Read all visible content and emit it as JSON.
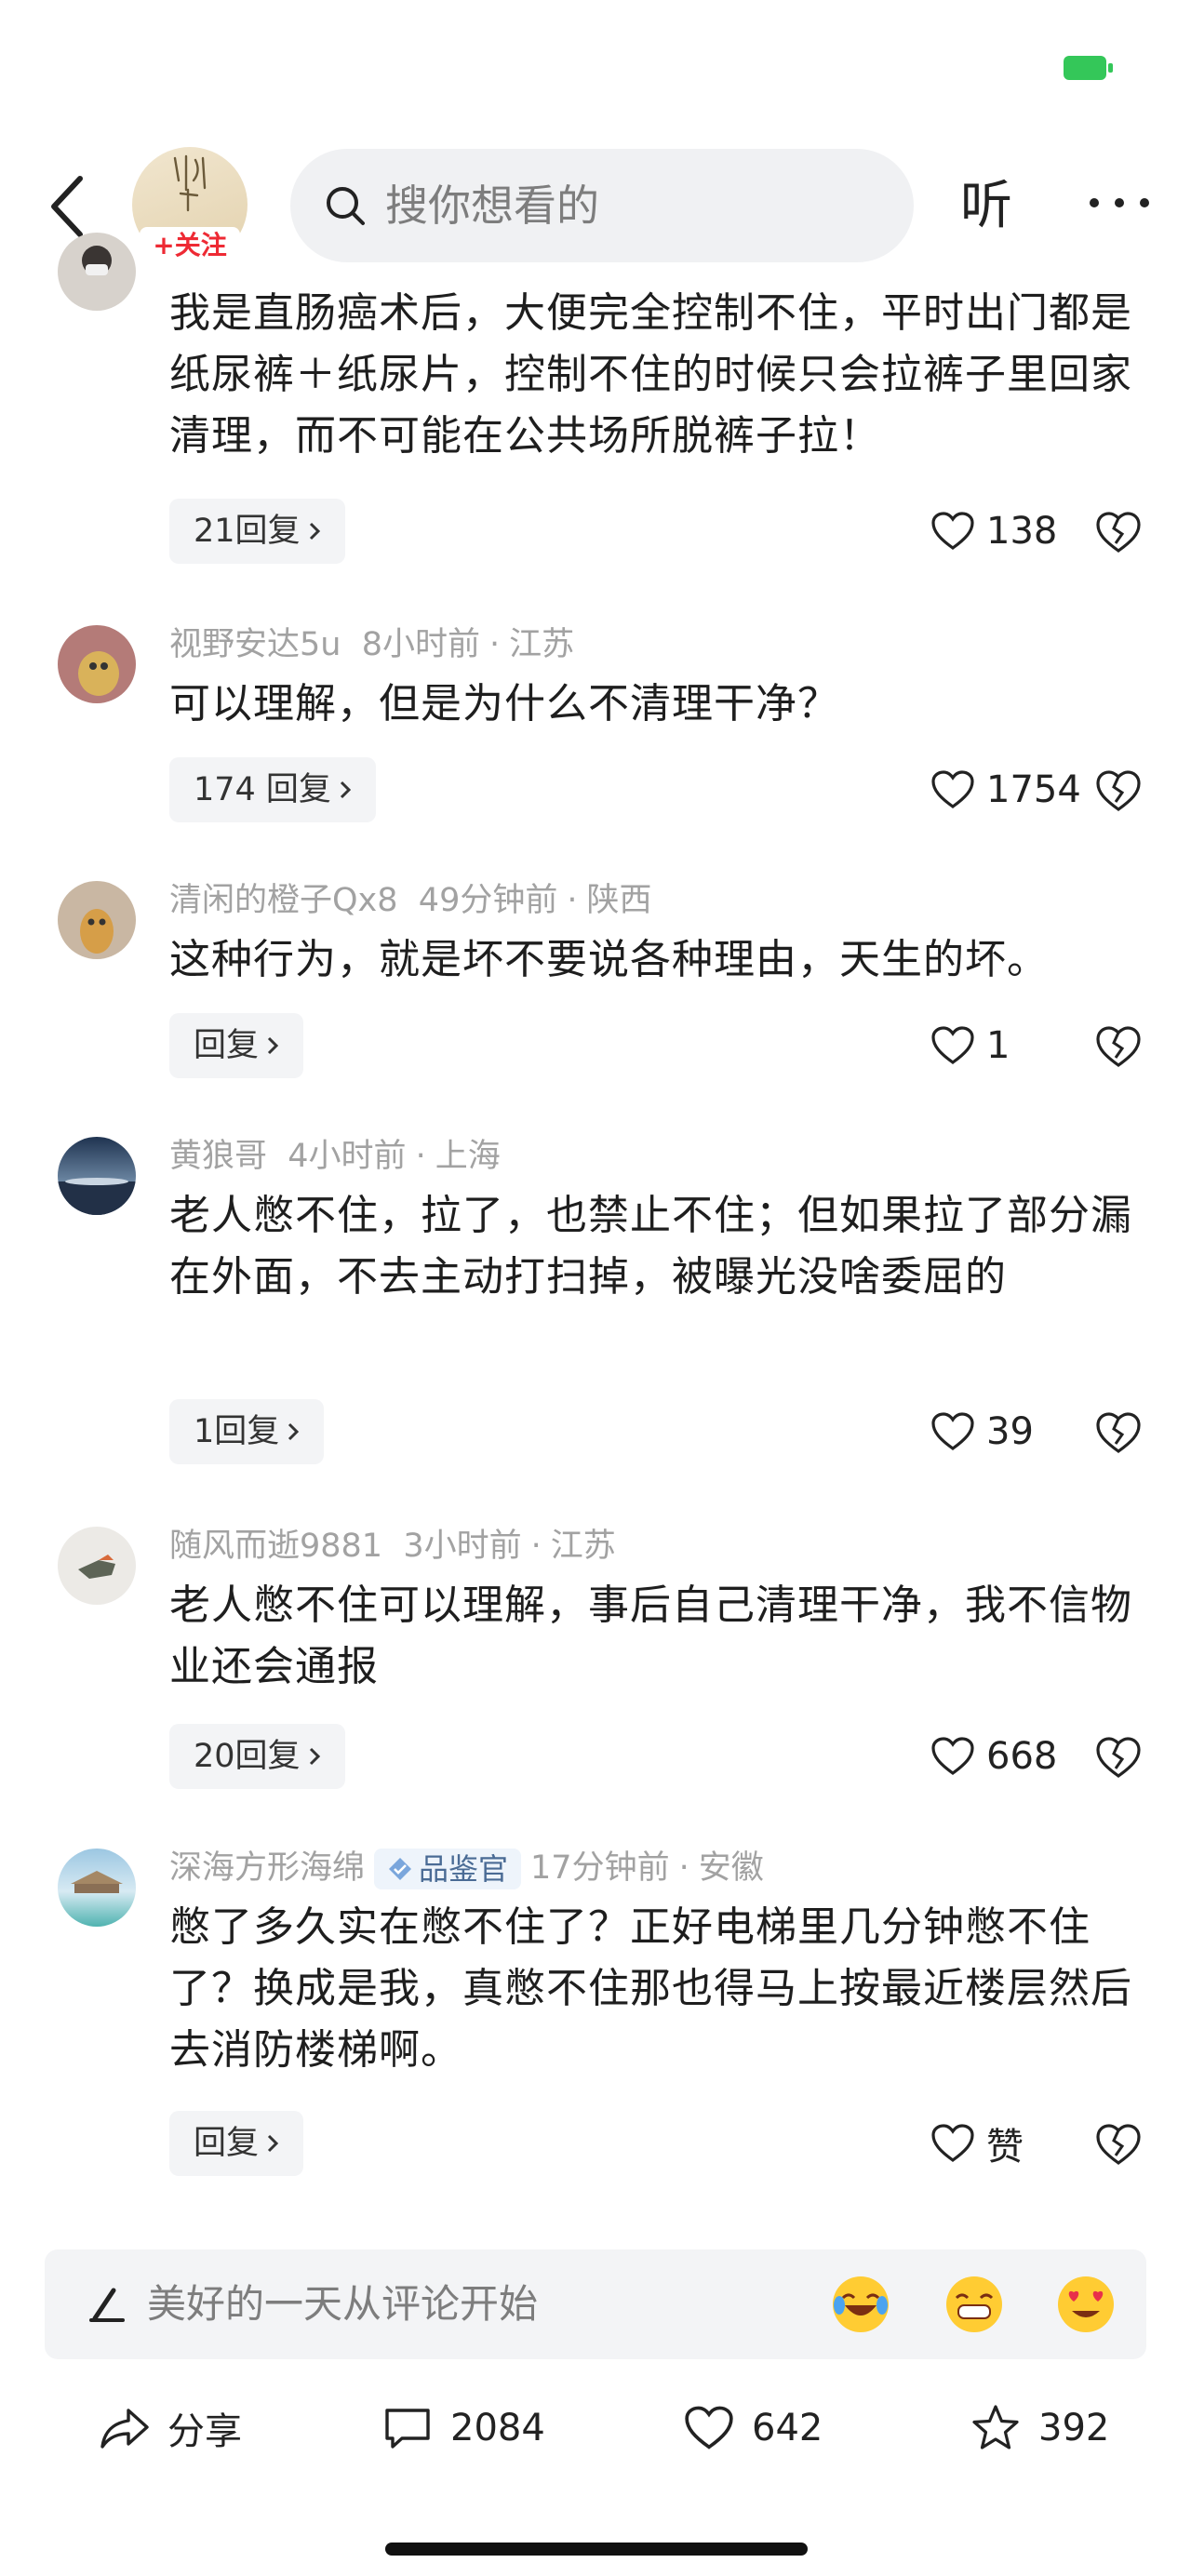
{
  "status": {
    "battery_color": "#34c759"
  },
  "header": {
    "follow_label": "+关注",
    "search_placeholder": "搜你想看的",
    "listen_label": "听"
  },
  "comments": [
    {
      "user": "",
      "time": "",
      "location": "",
      "text": "我是直肠癌术后，大便完全控制不住，平时出门都是纸尿裤＋纸尿片，控制不住的时候只会拉裤子里回家清理，而不可能在公共场所脱裤子拉！",
      "replies": "21回复",
      "likes": "138"
    },
    {
      "user": "视野安达5u",
      "time": "8小时前",
      "location": "江苏",
      "text": "可以理解，但是为什么不清理干净？",
      "replies": "174 回复",
      "likes": "1754"
    },
    {
      "user": "清闲的橙子Qx8",
      "time": "49分钟前",
      "location": "陕西",
      "text": "这种行为，就是坏不要说各种理由，天生的坏。",
      "replies": "回复",
      "likes": "1"
    },
    {
      "user": "黄狼哥",
      "time": "4小时前",
      "location": "上海",
      "text": "老人憋不住，拉了，也禁止不住；但如果拉了部分漏在外面，不去主动打扫掉，被曝光没啥委屈的",
      "replies": "1回复",
      "likes": "39"
    },
    {
      "user": "随风而逝9881",
      "time": "3小时前",
      "location": "江苏",
      "text": "老人憋不住可以理解，事后自己清理干净，我不信物业还会通报",
      "replies": "20回复",
      "likes": "668"
    },
    {
      "user": "深海方形海绵",
      "badge": "品鉴官",
      "time": "17分钟前",
      "location": "安徽",
      "text": "憋了多久实在憋不住了？正好电梯里几分钟憋不住了？换成是我，真憋不住那也得马上按最近楼层然后去消防楼梯啊。",
      "replies": "回复",
      "likes": "赞"
    }
  ],
  "input": {
    "placeholder": "美好的一天从评论开始"
  },
  "actions": {
    "share": "分享",
    "comments": "2084",
    "likes": "642",
    "favorites": "392"
  },
  "colors": {
    "accent_red": "#ee2a34",
    "meta_gray": "#a2a2a2",
    "badge_blue": "#4a6b95"
  }
}
